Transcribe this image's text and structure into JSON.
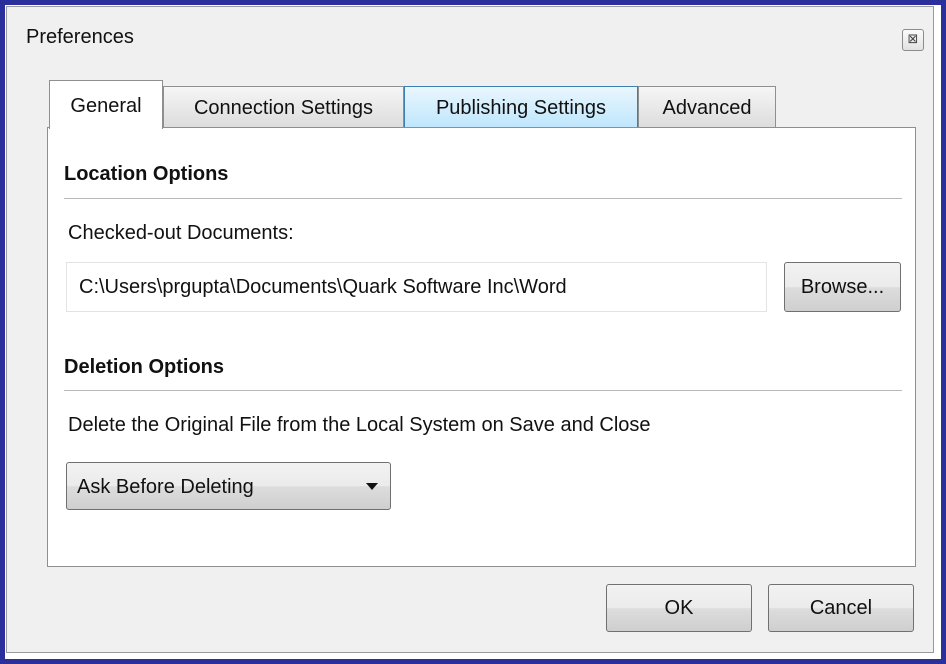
{
  "window": {
    "title": "Preferences",
    "close_glyph": "⊠"
  },
  "tabs": [
    {
      "label": "General",
      "active": true
    },
    {
      "label": "Connection Settings",
      "active": false
    },
    {
      "label": "Publishing Settings",
      "active": false,
      "hover": true
    },
    {
      "label": "Advanced",
      "active": false
    }
  ],
  "location": {
    "heading": "Location Options",
    "checked_out_label": "Checked-out Documents:",
    "path_value": "C:\\Users\\prgupta\\Documents\\Quark Software Inc\\Word",
    "browse_label": "Browse..."
  },
  "deletion": {
    "heading": "Deletion Options",
    "description": "Delete the Original File from the Local System on Save and Close",
    "selected_option": "Ask Before Deleting"
  },
  "footer": {
    "ok_label": "OK",
    "cancel_label": "Cancel"
  },
  "colors": {
    "outer_frame": "#2b2f9c",
    "dialog_background": "#f0f0f0",
    "hover_tab": "#bee6fd"
  }
}
